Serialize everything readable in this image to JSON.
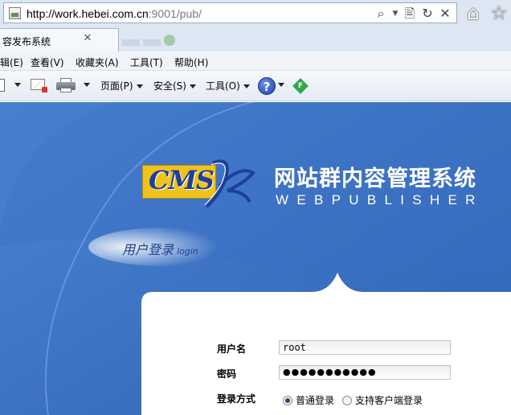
{
  "browser": {
    "url_host": "http://work.hebei.com.cn",
    "url_path": ":9001/pub/",
    "tab_title": "容发布系统",
    "menu": [
      "编辑(E)",
      "查看(V)",
      "收藏夹(A)",
      "工具(T)",
      "帮助(H)"
    ],
    "commands": {
      "page": "页面(P)",
      "safety": "安全(S)",
      "tools": "工具(O)",
      "help_glyph": "?",
      "ext_letter": "F"
    },
    "icons": {
      "search": "search-icon",
      "compat": "compatibility-view-icon",
      "refresh": "refresh-icon",
      "stop": "close-icon",
      "home": "home-icon",
      "favorites": "star-icon"
    }
  },
  "header": {
    "logo_text": "CMS",
    "system_title": "网站群内容管理系统",
    "system_subtitle": "WEBPUBLISHER"
  },
  "login": {
    "tag_main": "用户登录",
    "tag_sub": "login",
    "username_label": "用户名",
    "username_value": "root",
    "password_label": "密码",
    "password_mask": "●●●●●●●●●●●",
    "mode_label": "登录方式",
    "mode_options": [
      {
        "label": "普通登录",
        "selected": true
      },
      {
        "label": "支持客户端登录",
        "selected": false
      }
    ]
  },
  "colors": {
    "page_blue": "#3f75c6",
    "logo_yellow": "#f0c21c",
    "logo_blue": "#1d3f9a"
  }
}
